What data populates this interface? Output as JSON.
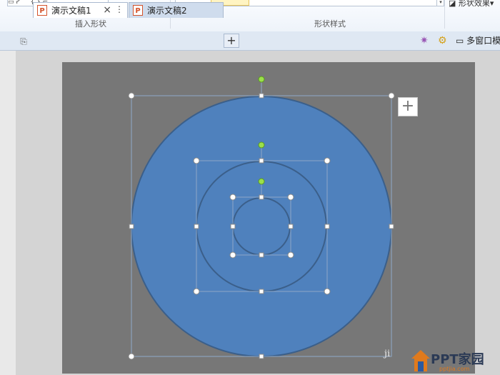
{
  "ribbon": {
    "insert_shape_label": "插入形状",
    "shape_style_label": "形状样式",
    "shape_effect_label": "形状效果",
    "shape_effect_arrow": "▾",
    "mini_shapes": "▭ ᓯ ⌒ { } ⌐",
    "dropdown_arrow": "▾"
  },
  "tabs": [
    {
      "label": "演示文稿1",
      "icon": "P",
      "active": true
    },
    {
      "label": "演示文稿2",
      "icon": "P",
      "active": false
    }
  ],
  "tab_close": "×",
  "tab_more": "⋮",
  "new_tab": "+",
  "home_icon": "⎘",
  "multiwindow_label": "多窗口模",
  "slide": {
    "background": "#777777",
    "fill": "#4f81bd",
    "outline": "#3b5f8a",
    "add_button": "+"
  },
  "watermark": {
    "corner": "ji",
    "brand": "PPT家园",
    "site": "pptjia.com"
  }
}
